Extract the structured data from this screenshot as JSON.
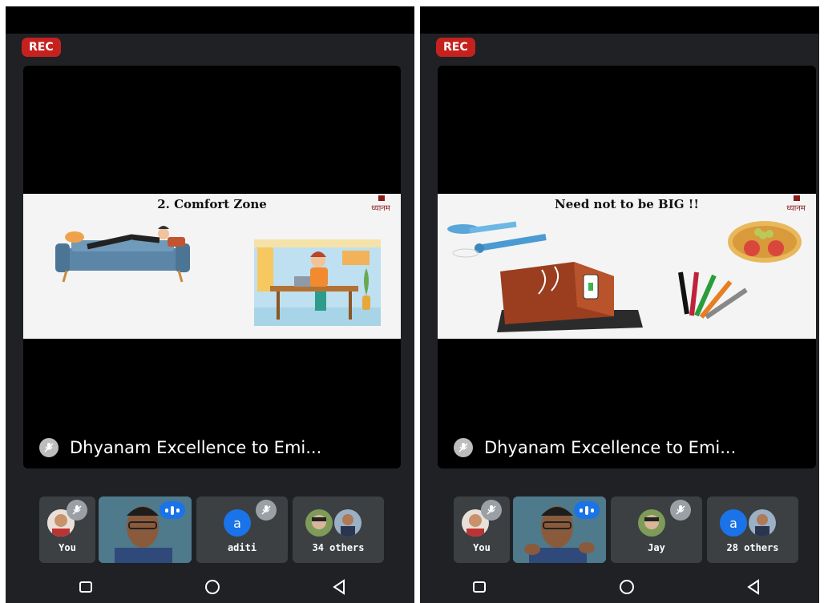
{
  "screens": [
    {
      "rec_label": "REC",
      "slide_title": "2. Comfort Zone",
      "logo_text": "ध्यानम",
      "caption": "Dhyanam Excellence to Emi...",
      "tiles": [
        "You",
        "aditi",
        "34 others"
      ],
      "tile_avatar_letter": "a"
    },
    {
      "rec_label": "REC",
      "slide_title": "Need not to be BIG !!",
      "logo_text": "ध्यानम",
      "caption": "Dhyanam Excellence to Emi...",
      "tiles": [
        "You",
        "Jay",
        "28 others"
      ],
      "tile_avatar_letter": "a"
    }
  ],
  "colors": {
    "background": "#202124",
    "rec": "#c5221f",
    "accent": "#1a73e8",
    "tile": "#3c4043"
  },
  "icons": [
    "mic-off-icon",
    "speaking-indicator-icon",
    "recents-nav-icon",
    "home-nav-icon",
    "back-nav-icon"
  ]
}
